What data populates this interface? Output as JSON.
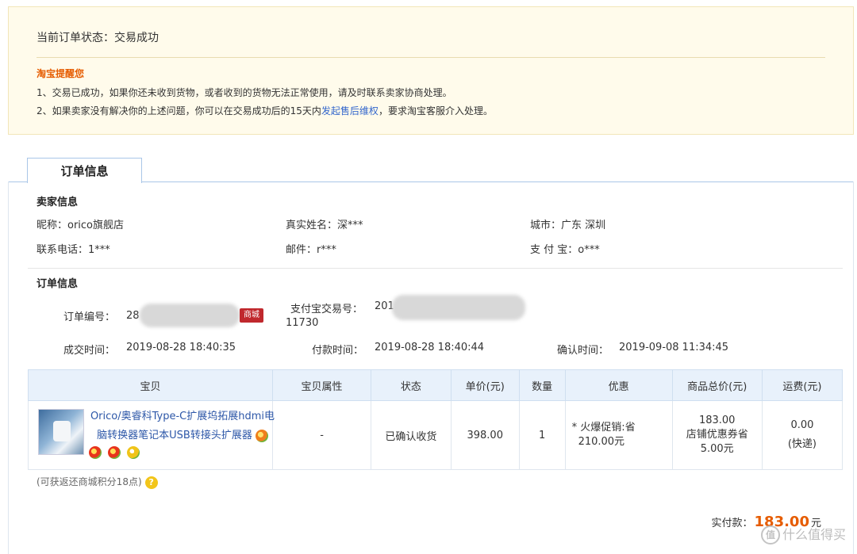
{
  "status": {
    "line": "当前订单状态：交易成功",
    "reminder_title": "淘宝提醒您",
    "reminder_line1": "1、交易已成功，如果你还未收到货物，或者收到的货物无法正常使用，请及时联系卖家协商处理。",
    "reminder_line2_prefix": "2、如果卖家没有解决你的上述问题，你可以在交易成功后的15天内",
    "reminder_line2_link": "发起售后维权",
    "reminder_line2_suffix": "，要求淘宝客服介入处理。"
  },
  "tab": {
    "label": "订单信息"
  },
  "seller": {
    "section_title": "卖家信息",
    "nickname": "昵称：orico旗舰店",
    "real_name": "真实姓名：深***",
    "city": "城市：广东 深圳",
    "phone": "联系电话：1***",
    "email": "邮件：r***",
    "alipay": "支 付 宝：o***"
  },
  "order": {
    "section_title": "订单信息",
    "order_no_label": "订单编号：",
    "order_no_prefix": "28",
    "tmall_badge": "商城",
    "alipay_no_label": "支付宝交易号：",
    "alipay_no_prefix": "201",
    "alipay_no_suffix": "11730",
    "deal_time_label": "成交时间：",
    "deal_time": "2019-08-28 18:40:35",
    "pay_time_label": "付款时间：",
    "pay_time": "2019-08-28 18:40:44",
    "confirm_time_label": "确认时间：",
    "confirm_time": "2019-09-08 11:34:45"
  },
  "table": {
    "headers": [
      "宝贝",
      "宝贝属性",
      "状态",
      "单价(元)",
      "数量",
      "优惠",
      "商品总价(元)",
      "运费(元)"
    ],
    "row": {
      "product_name": "Orico/奥睿科Type-C扩展坞拓展hdmi电脑转换器笔记本USB转接头扩展器",
      "attribute": "-",
      "status": "已确认收货",
      "unit_price": "398.00",
      "quantity": "1",
      "promo_line1": "* 火爆促销:省",
      "promo_line2": "210.00元",
      "total_line1": "183.00",
      "total_line2": "店铺优惠券省",
      "total_line3": "5.00元",
      "shipping_line1": "0.00",
      "shipping_line2": "(快递)"
    }
  },
  "points": {
    "text": "(可获返还商城积分18点)",
    "help_icon": "?"
  },
  "paid": {
    "label_prefix": "实付款：",
    "amount": "183.00",
    "unit": "元"
  },
  "watermark": {
    "logo": "值",
    "text": "什么值得买"
  },
  "colors": {
    "accent_orange": "#e65c00",
    "link_blue": "#2d57a8",
    "header_bg": "#e8f1fb",
    "status_bg": "#fffbeb"
  }
}
